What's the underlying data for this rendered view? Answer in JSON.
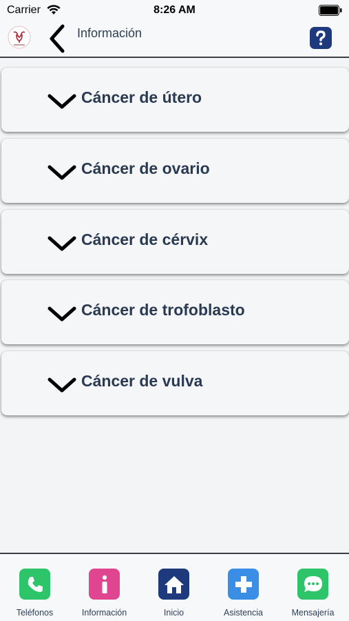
{
  "status_bar": {
    "carrier": "Carrier",
    "time": "8:26 AM"
  },
  "nav": {
    "title": "Información",
    "back_icon": "chevron-left-icon",
    "help_icon": "question-icon",
    "logo_icon": "uterus-logo-icon"
  },
  "sections": [
    {
      "label": "Cáncer de útero"
    },
    {
      "label": "Cáncer de ovario"
    },
    {
      "label": "Cáncer de cérvix"
    },
    {
      "label": "Cáncer de trofoblasto"
    },
    {
      "label": "Cáncer de vulva"
    }
  ],
  "tabs": [
    {
      "label": "Teléfonos",
      "icon": "phone-icon",
      "color": "#2ec46a"
    },
    {
      "label": "Información",
      "icon": "info-icon",
      "color": "#e0458f"
    },
    {
      "label": "Inicio",
      "icon": "home-icon",
      "color": "#1f3a7c"
    },
    {
      "label": "Asistencia",
      "icon": "medical-cross-icon",
      "color": "#3a8ee6"
    },
    {
      "label": "Mensajería",
      "icon": "chat-bubble-icon",
      "color": "#2ec46a"
    }
  ],
  "colors": {
    "text_dark": "#2a3a52",
    "help_button": "#1f3a7c"
  }
}
